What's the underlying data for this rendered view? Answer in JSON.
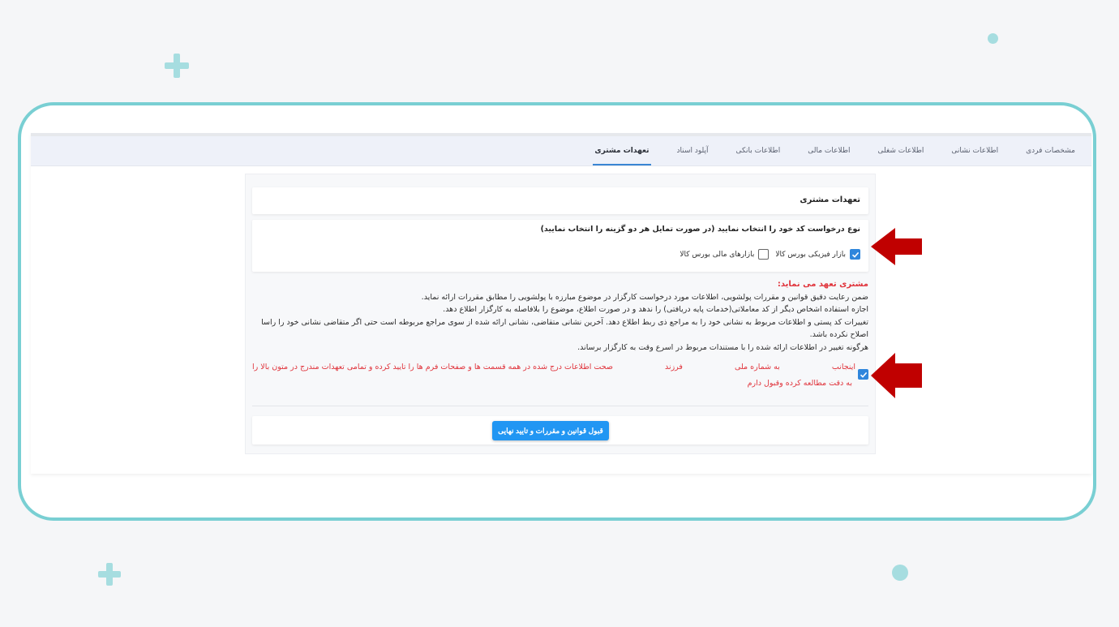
{
  "tabs": [
    {
      "label": "مشخصات فردی",
      "active": false
    },
    {
      "label": "اطلاعات نشانی",
      "active": false
    },
    {
      "label": "اطلاعات شغلی",
      "active": false
    },
    {
      "label": "اطلاعات مالی",
      "active": false
    },
    {
      "label": "اطلاعات بانکی",
      "active": false
    },
    {
      "label": "آپلود اسناد",
      "active": false
    },
    {
      "label": "تعهدات مشتری",
      "active": true
    }
  ],
  "section_title": "تعهدات مشتری",
  "request_type": {
    "question": "نوع درخواست کد خود را انتخاب نمایید (در صورت تمایل هر دو گزینه را انتخاب نمایید)",
    "options": [
      {
        "label": "بازار فیزیکی بورس کالا",
        "checked": true
      },
      {
        "label": "بازارهای مالی بورس کالا",
        "checked": false
      }
    ]
  },
  "commitments": {
    "heading": "مشتری تعهد می نماید:",
    "lines": [
      "ضمن رعایت دقیق قوانین و مقررات پولشویی، اطلاعات مورد درخواست کارگزار در موضوع مبارزه با پولشویی را مطابق مقررات ارائه نماید.",
      "اجازه استفاده اشخاص دیگر از کد معاملاتی(خدمات پایه دریافتی) را ندهد و در صورت اطلاع، موضوع را بلافاصله به کارگزار اطلاع دهد.",
      "تغییرات کد پستی و اطلاعات مربوط به نشانی خود را به مراجع ذی ربط اطلاع دهد. آخرین نشانی متقاضی، نشانی ارائه شده از سوی مراجع مربوطه است حتی اگر متقاضی نشانی خود را راسا اصلاح نکرده باشد.",
      "هرگونه تغییر در اطلاعات ارائه شده را با مستندات مربوط در اسرع وقت به کارگزار برساند."
    ]
  },
  "agreement": {
    "checked": true,
    "part_1": "اینجانب",
    "part_2": "به شماره ملی",
    "part_3": "فرزند",
    "part_4": "صحت اطلاعات درج شده در همه قسمت ها و صفحات فرم ها را تایید کرده و تمامی تعهدات مندرج در متون بالا را",
    "part_5": "به دقت مطالعه کرده وقبول دارم"
  },
  "submit_button": "قبول قوانین و مقررات و تایید نهایی",
  "colors": {
    "accent": "#2196f3",
    "warning_text": "#e0333b",
    "arrow": "#c00000",
    "frame": "#79cfd3"
  }
}
